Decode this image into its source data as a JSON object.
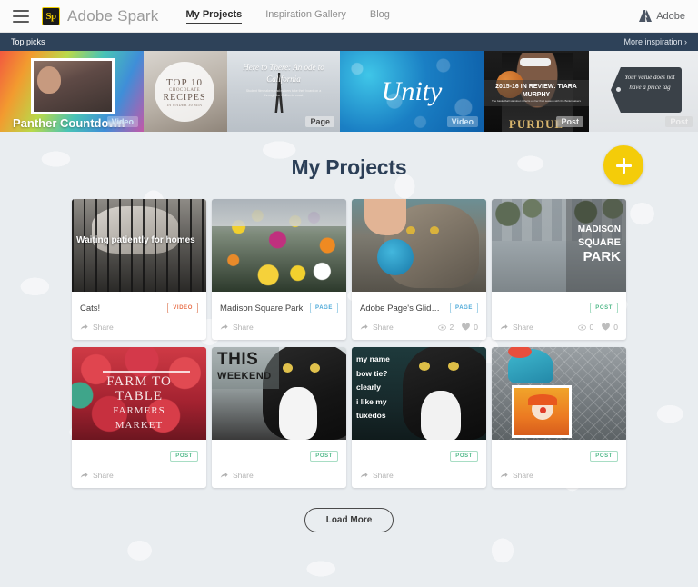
{
  "header": {
    "menu_icon": "hamburger-icon",
    "logo_mark": "Sp",
    "logo_text": "Adobe Spark",
    "nav": [
      {
        "label": "My Projects",
        "active": true
      },
      {
        "label": "Inspiration Gallery",
        "active": false
      },
      {
        "label": "Blog",
        "active": false
      }
    ],
    "brand_label": "Adobe",
    "brand_icon": "adobe-a-icon"
  },
  "toppicks": {
    "label": "Top picks",
    "more_label": "More inspiration ›"
  },
  "carousel": [
    {
      "title": "Panther Countdown",
      "badge": "Video"
    },
    {
      "title": "TOP 10 CHOCOLATE RECIPES IN UNDER 30 MIN",
      "line1": "TOP 10",
      "line2": "CHOCOLATE",
      "line3": "RECIPES",
      "line4": "IN UNDER 30 MIN",
      "badge": ""
    },
    {
      "title": "Here to There: An ode to California",
      "subtitle": "Student filmmakers and makers take their board on a through the California coast",
      "badge": "Page"
    },
    {
      "title": "Unity",
      "badge": "Video"
    },
    {
      "title": "2015-16 IN REVIEW: TIARA MURPHY",
      "subtitle": "The basketball standout reflects on her final season with the Boilermakers",
      "wordmark": "PURDUE",
      "badge": "Post"
    },
    {
      "title": "Your value does not have a price tag",
      "badge": "Post"
    },
    {
      "title": "",
      "badge": ""
    }
  ],
  "main": {
    "page_title": "My Projects",
    "create_button": "create-project-button",
    "load_more": "Load More",
    "share_label": "Share",
    "projects": [
      {
        "title": "Cats!",
        "badge": "VIDEO",
        "badge_type": "video",
        "overlay_text": "Waiting patiently for homes",
        "share": "Share",
        "views": null,
        "likes": null
      },
      {
        "title": "Madison Square Park",
        "badge": "PAGE",
        "badge_type": "page",
        "overlay_text": "",
        "share": "Share",
        "views": null,
        "likes": null
      },
      {
        "title": "Adobe Page's Glideshow",
        "badge": "PAGE",
        "badge_type": "page",
        "overlay_text": "",
        "share": "Share",
        "views": "2",
        "likes": "0"
      },
      {
        "title": "",
        "badge": "POST",
        "badge_type": "post",
        "overlay_l1": "MADISON",
        "overlay_l2": "SQUARE",
        "overlay_l3": "PARK",
        "share": "Share",
        "views": "0",
        "likes": "0"
      },
      {
        "title": "",
        "badge": "POST",
        "badge_type": "post",
        "overlay_a": "FARM TO",
        "overlay_b": "TABLE",
        "overlay_c": "FARMERS",
        "overlay_d": "MARKET",
        "share": "Share",
        "views": null,
        "likes": null
      },
      {
        "title": "",
        "badge": "POST",
        "badge_type": "post",
        "overlay_t1": "THIS",
        "overlay_t2": "WEEKEND",
        "share": "Share",
        "views": null,
        "likes": null
      },
      {
        "title": "",
        "badge": "POST",
        "badge_type": "post",
        "meme_lines": "my name\nbow tie?\nclearly\ni like my\ntuxedos",
        "share": "Share",
        "views": null,
        "likes": null
      },
      {
        "title": "",
        "badge": "POST",
        "badge_type": "post",
        "share": "Share",
        "views": null,
        "likes": null
      }
    ]
  },
  "colors": {
    "accent_yellow": "#f4cc09",
    "topbar_navy": "#2e4259",
    "title_navy": "#2c3f57",
    "page_bg": "#e9edf0",
    "badge_video": "#e8704a",
    "badge_page": "#4aa8d8",
    "badge_post": "#52b98a"
  }
}
